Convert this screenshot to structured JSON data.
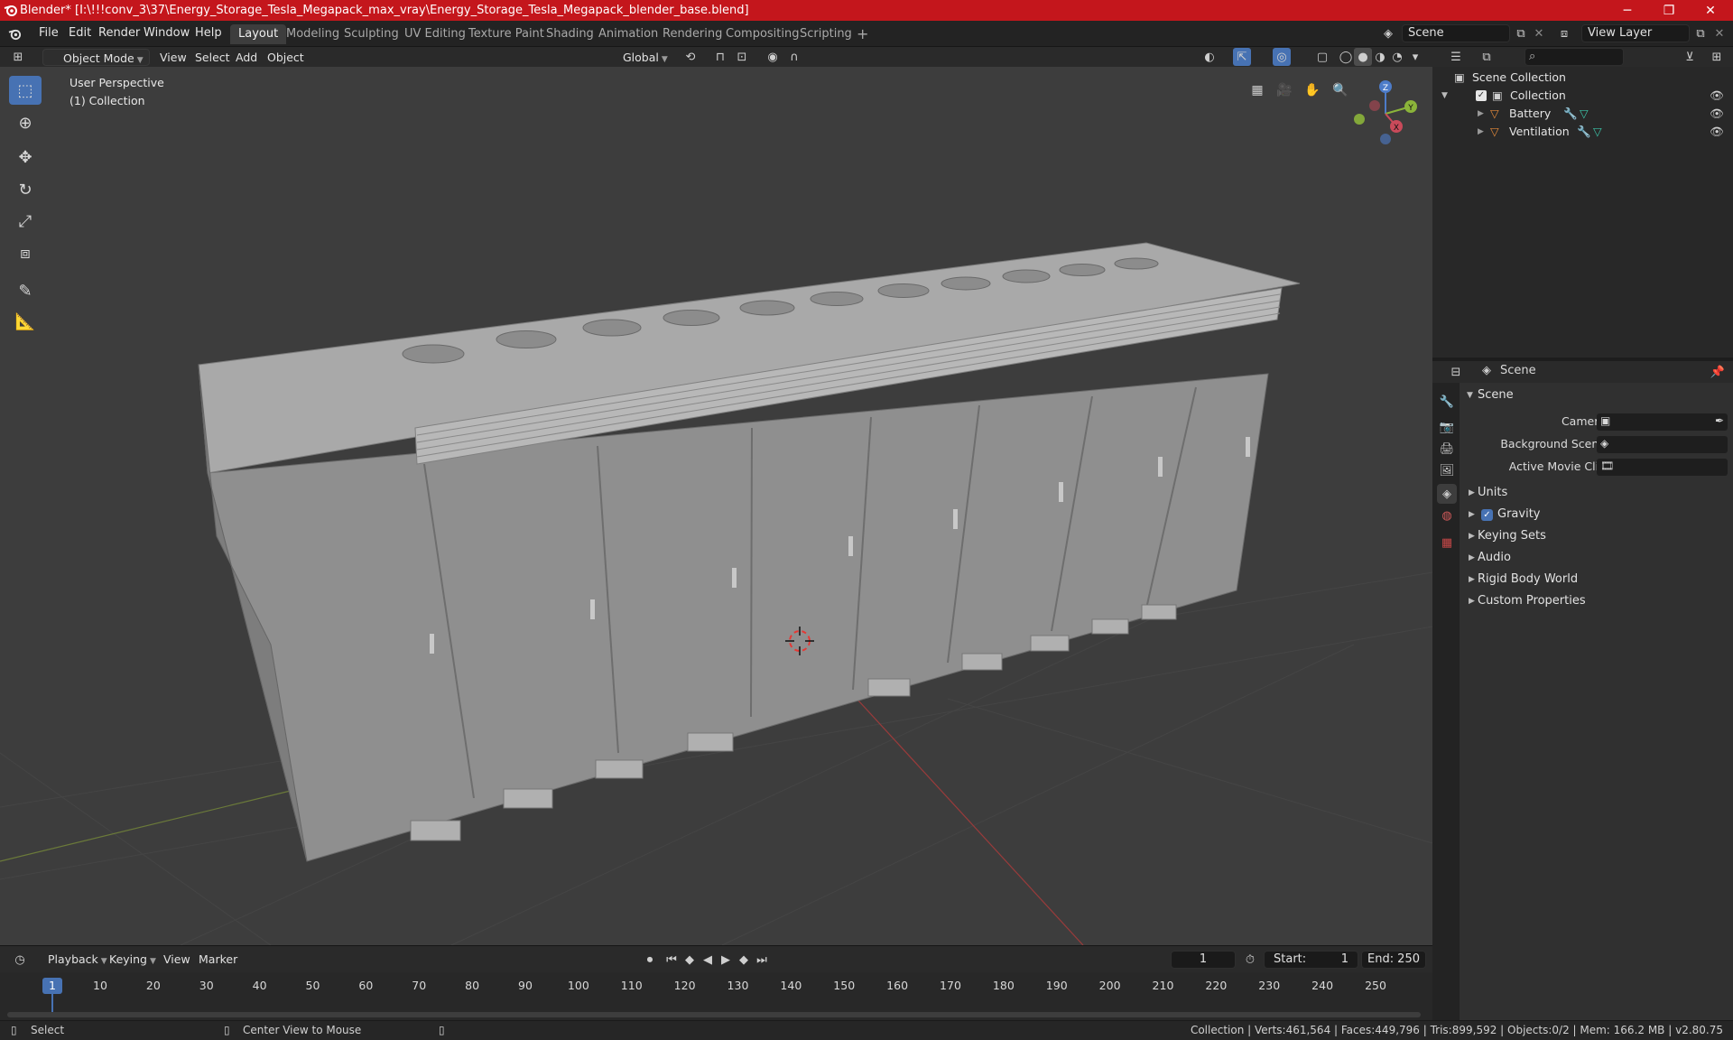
{
  "titlebar": {
    "title": "Blender* [I:\\!!!conv_3\\37\\Energy_Storage_Tesla_Megapack_max_vray\\Energy_Storage_Tesla_Megapack_blender_base.blend]",
    "minimize": "─",
    "maximize": "❐",
    "close": "✕"
  },
  "menu": {
    "items": [
      "File",
      "Edit",
      "Render",
      "Window",
      "Help"
    ]
  },
  "workspaces": {
    "tabs": [
      "Layout",
      "Modeling",
      "Sculpting",
      "UV Editing",
      "Texture Paint",
      "Shading",
      "Animation",
      "Rendering",
      "Compositing",
      "Scripting"
    ],
    "active": "Layout",
    "add": "+"
  },
  "scene_selector": {
    "value": "Scene"
  },
  "view_layer_selector": {
    "value": "View Layer"
  },
  "viewport_header": {
    "mode": "Object Mode",
    "menus": [
      "View",
      "Select",
      "Add",
      "Object"
    ],
    "orientation": "Global"
  },
  "viewport": {
    "perspective_label": "User Perspective",
    "collection_label": "(1) Collection",
    "gizmo_axes": {
      "z": "Z",
      "y": "Y",
      "x": "X"
    }
  },
  "outliner": {
    "search_placeholder": "",
    "root": "Scene Collection",
    "collection": "Collection",
    "objects": [
      "Battery",
      "Ventilation"
    ]
  },
  "properties": {
    "header_title": "Scene",
    "panel_title": "Scene",
    "camera_label": "Camera",
    "background_scene_label": "Background Scene",
    "active_movie_clip_label": "Active Movie Clip",
    "sections": [
      "Units",
      "Gravity",
      "Keying Sets",
      "Audio",
      "Rigid Body World",
      "Custom Properties"
    ],
    "gravity_checked": true
  },
  "timeline": {
    "menus": [
      "Playback",
      "Keying",
      "View",
      "Marker"
    ],
    "current_frame": "1",
    "start_label": "Start:",
    "start_value": "1",
    "end_label": "End:",
    "end_value": "250",
    "ticks": [
      "1",
      "10",
      "20",
      "30",
      "40",
      "50",
      "60",
      "70",
      "80",
      "90",
      "100",
      "110",
      "120",
      "130",
      "140",
      "150",
      "160",
      "170",
      "180",
      "190",
      "200",
      "210",
      "220",
      "230",
      "240",
      "250"
    ]
  },
  "statusbar": {
    "select": "Select",
    "center_view": "Center View to Mouse",
    "stats": "Collection | Verts:461,564 | Faces:449,796 | Tris:899,592 | Objects:0/2 | Mem: 166.2 MB | v2.80.75"
  },
  "colors": {
    "titlebar": "#c4161c",
    "accent": "#4772b3",
    "viewport_bg": "#3d3d3d"
  }
}
